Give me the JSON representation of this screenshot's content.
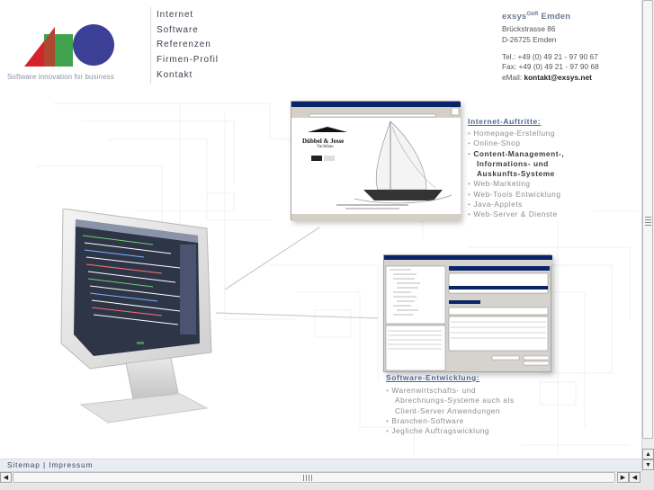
{
  "logo": {
    "tagline": "Software innovation for business"
  },
  "nav": {
    "items": [
      "Internet",
      "Software",
      "Referenzen",
      "Firmen-Profil",
      "Kontakt"
    ]
  },
  "contact": {
    "company": "exsys",
    "company_suffix": "GbR",
    "city": "Emden",
    "street": "Brückstrasse 86",
    "zip_city": "D-26725 Emden",
    "tel": "Tel.: +49 (0) 49 21 - 97 90 67",
    "fax": "Fax: +49 (0) 49 21 - 97 90 68",
    "email_label": "eMail:",
    "email": "kontakt@exsys.net"
  },
  "internet": {
    "title": "Internet-Auftritte:",
    "items": [
      {
        "text": "Homepage-Erstellung",
        "bold": false
      },
      {
        "text": "Online-Shop",
        "bold": false
      },
      {
        "text": "Content-Management-,",
        "bold": true
      },
      {
        "text": "Informations- und",
        "bold": true,
        "cont": true
      },
      {
        "text": "Auskunfts-Systeme",
        "bold": true,
        "cont": true
      },
      {
        "text": "Web-Marketing",
        "bold": false
      },
      {
        "text": "Web-Tools Entwicklung",
        "bold": false
      },
      {
        "text": "Java-Applets",
        "bold": false
      },
      {
        "text": "Web-Server & Dienste",
        "bold": false
      }
    ]
  },
  "software": {
    "title": "Software-Entwicklung:",
    "items": [
      {
        "text": "Warenwirtschafts- und",
        "bold": false
      },
      {
        "text": "Abrechnungs-Systeme auch als",
        "bold": false,
        "cont": true
      },
      {
        "text": "Client-Server Anwendungen",
        "bold": false,
        "cont": true
      },
      {
        "text": "Branchen-Software",
        "bold": false
      },
      {
        "text": "Jegliche Auftragswicklung",
        "bold": false
      }
    ]
  },
  "screenshot_web": {
    "brand": "Dübbel & Jesse",
    "brand_sub": "Yachtbau"
  },
  "footer": {
    "sitemap": "Sitemap",
    "separator": "|",
    "impressum": "Impressum"
  },
  "colors": {
    "accent": "#4d6591",
    "logo_red": "#d4232a",
    "logo_green": "#3fa34d",
    "logo_blue": "#3b3f95"
  }
}
